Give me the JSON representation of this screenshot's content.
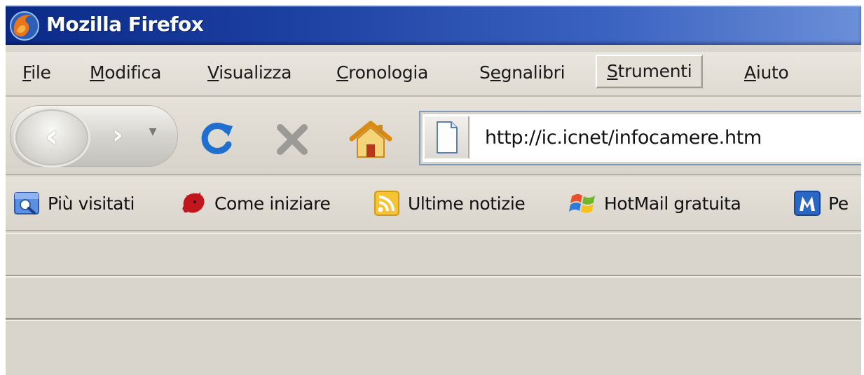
{
  "window": {
    "title": "Mozilla Firefox"
  },
  "menu": {
    "items": [
      {
        "accel": "F",
        "rest": "ile"
      },
      {
        "accel": "M",
        "rest": "odifica"
      },
      {
        "accel": "V",
        "rest": "isualizza"
      },
      {
        "accel": "C",
        "rest": "ronologia"
      },
      {
        "pre": "S",
        "accel": "e",
        "rest": "gnalibri"
      },
      {
        "accel": "S",
        "rest": "trumenti",
        "active": true
      },
      {
        "accel": "A",
        "rest": "iuto"
      }
    ]
  },
  "navigation": {
    "back_glyph": "‹",
    "forward_glyph": "›",
    "dropdown_glyph": "▼"
  },
  "urlbar": {
    "value": "http://ic.icnet/infocamere.htm"
  },
  "bookmarks": {
    "items": [
      {
        "label": "Più visitati",
        "icon": "most-visited-icon"
      },
      {
        "label": "Come iniziare",
        "icon": "firefox-logo-icon"
      },
      {
        "label": "Ultime notizie",
        "icon": "rss-feed-icon"
      },
      {
        "label": "HotMail gratuita",
        "icon": "windows-flag-icon"
      },
      {
        "label": "Pe",
        "icon": "m-letter-icon"
      }
    ]
  }
}
